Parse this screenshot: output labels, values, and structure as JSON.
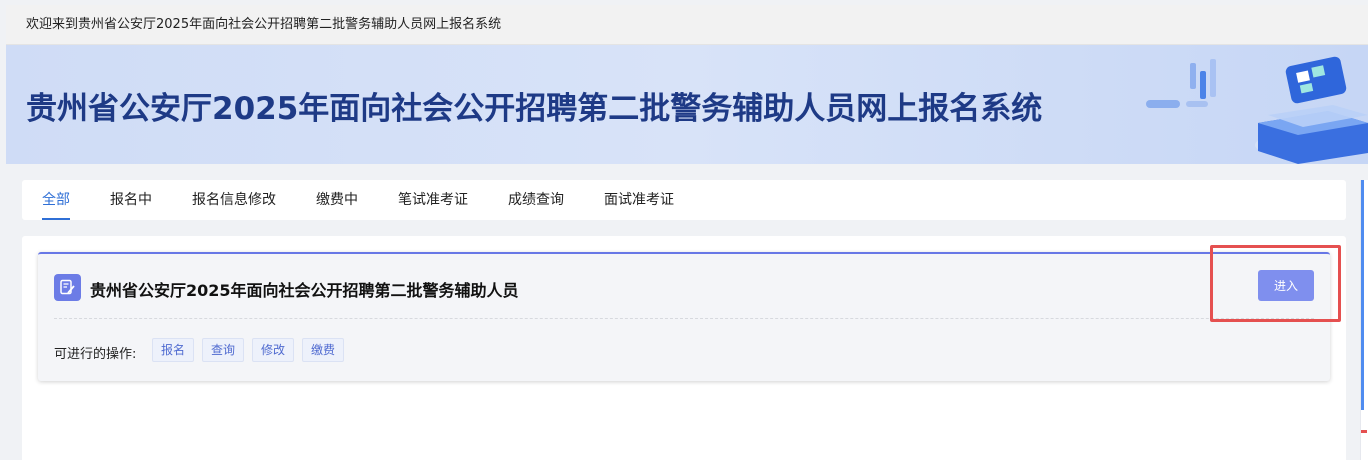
{
  "topbar": {
    "welcome_text": "欢迎来到贵州省公安厅2025年面向社会公开招聘第二批警务辅助人员网上报名系统"
  },
  "banner": {
    "title": "贵州省公安厅2025年面向社会公开招聘第二批警务辅助人员网上报名系统"
  },
  "tabs": [
    {
      "label": "全部",
      "active": true
    },
    {
      "label": "报名中",
      "active": false
    },
    {
      "label": "报名信息修改",
      "active": false
    },
    {
      "label": "缴费中",
      "active": false
    },
    {
      "label": "笔试准考证",
      "active": false
    },
    {
      "label": "成绩查询",
      "active": false
    },
    {
      "label": "面试准考证",
      "active": false
    }
  ],
  "exam_item": {
    "title": "贵州省公安厅2025年面向社会公开招聘第二批警务辅助人员",
    "enter_label": "进入",
    "ops_label": "可进行的操作:",
    "ops": [
      "报名",
      "查询",
      "修改",
      "缴费"
    ],
    "icon": "edit-document-icon"
  },
  "colors": {
    "accent": "#2f6fd6",
    "button": "#7f8fee",
    "banner_title": "#1e3a86",
    "highlight": "#e55050"
  }
}
